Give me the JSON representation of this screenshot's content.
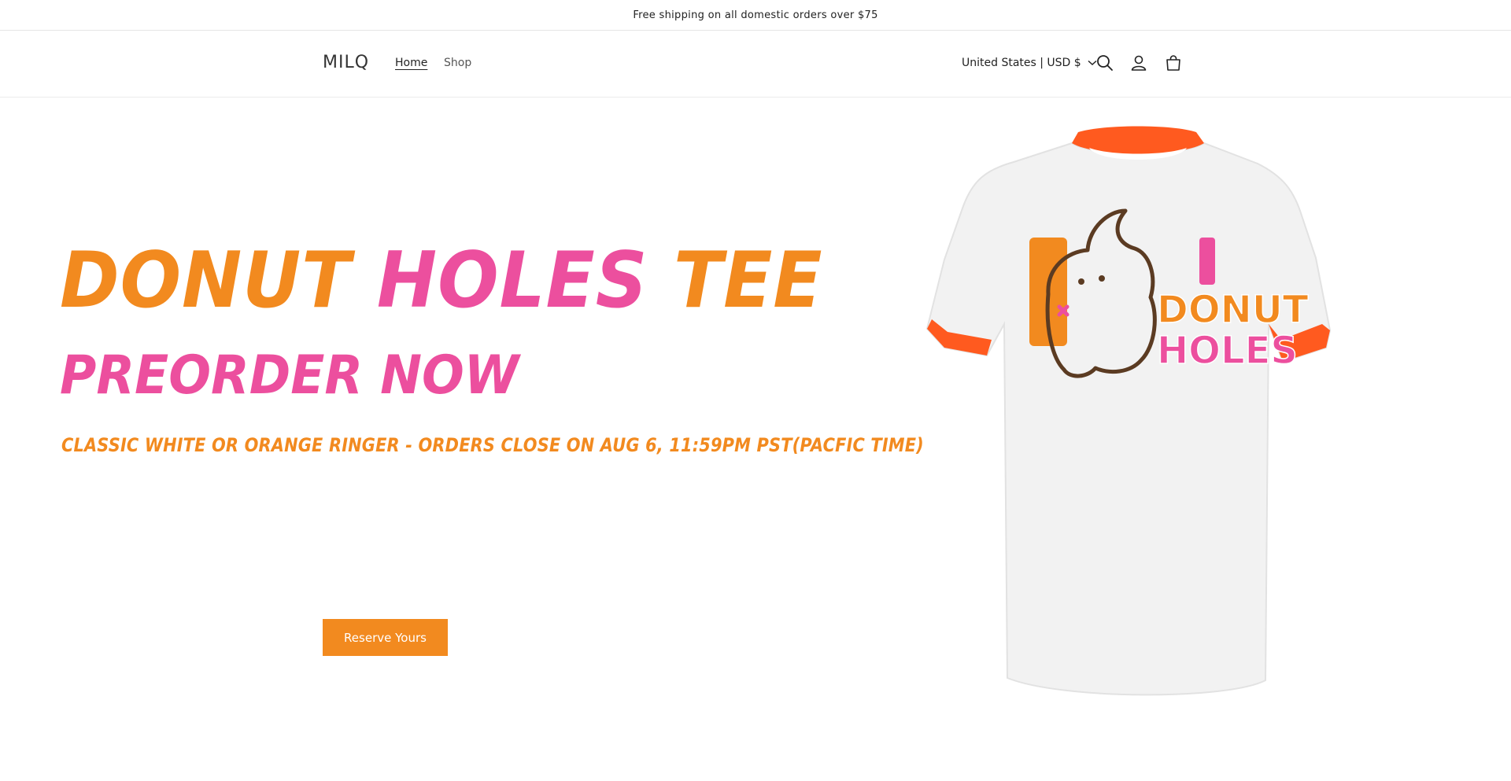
{
  "announcement": "Free shipping on all domestic orders over $75",
  "header": {
    "logo": "MILQ",
    "nav": [
      {
        "label": "Home",
        "active": true
      },
      {
        "label": "Shop",
        "active": false
      }
    ],
    "locale": "United States | USD $",
    "icons": [
      "search-icon",
      "account-icon",
      "cart-icon"
    ]
  },
  "hero": {
    "title_words": [
      {
        "text": "DONUT",
        "color": "#f28a1f"
      },
      {
        "text": "HOLES",
        "color": "#ec4f9e"
      },
      {
        "text": "TEE",
        "color": "#f28a1f"
      }
    ],
    "subtitle": "PREORDER NOW",
    "detail": "CLASSIC WHITE OR ORANGE RINGER - ORDERS CLOSE ON AUG 6, 11:59PM PST(PACFIC TIME)",
    "cta_label": "Reserve Yours",
    "shirt_graphic_text": [
      "DONUT",
      "HOLES"
    ]
  },
  "colors": {
    "orange": "#f28a1f",
    "pink": "#ec4f9e",
    "ringer": "#ff5a1f",
    "cat_outline": "#5b3b22"
  }
}
